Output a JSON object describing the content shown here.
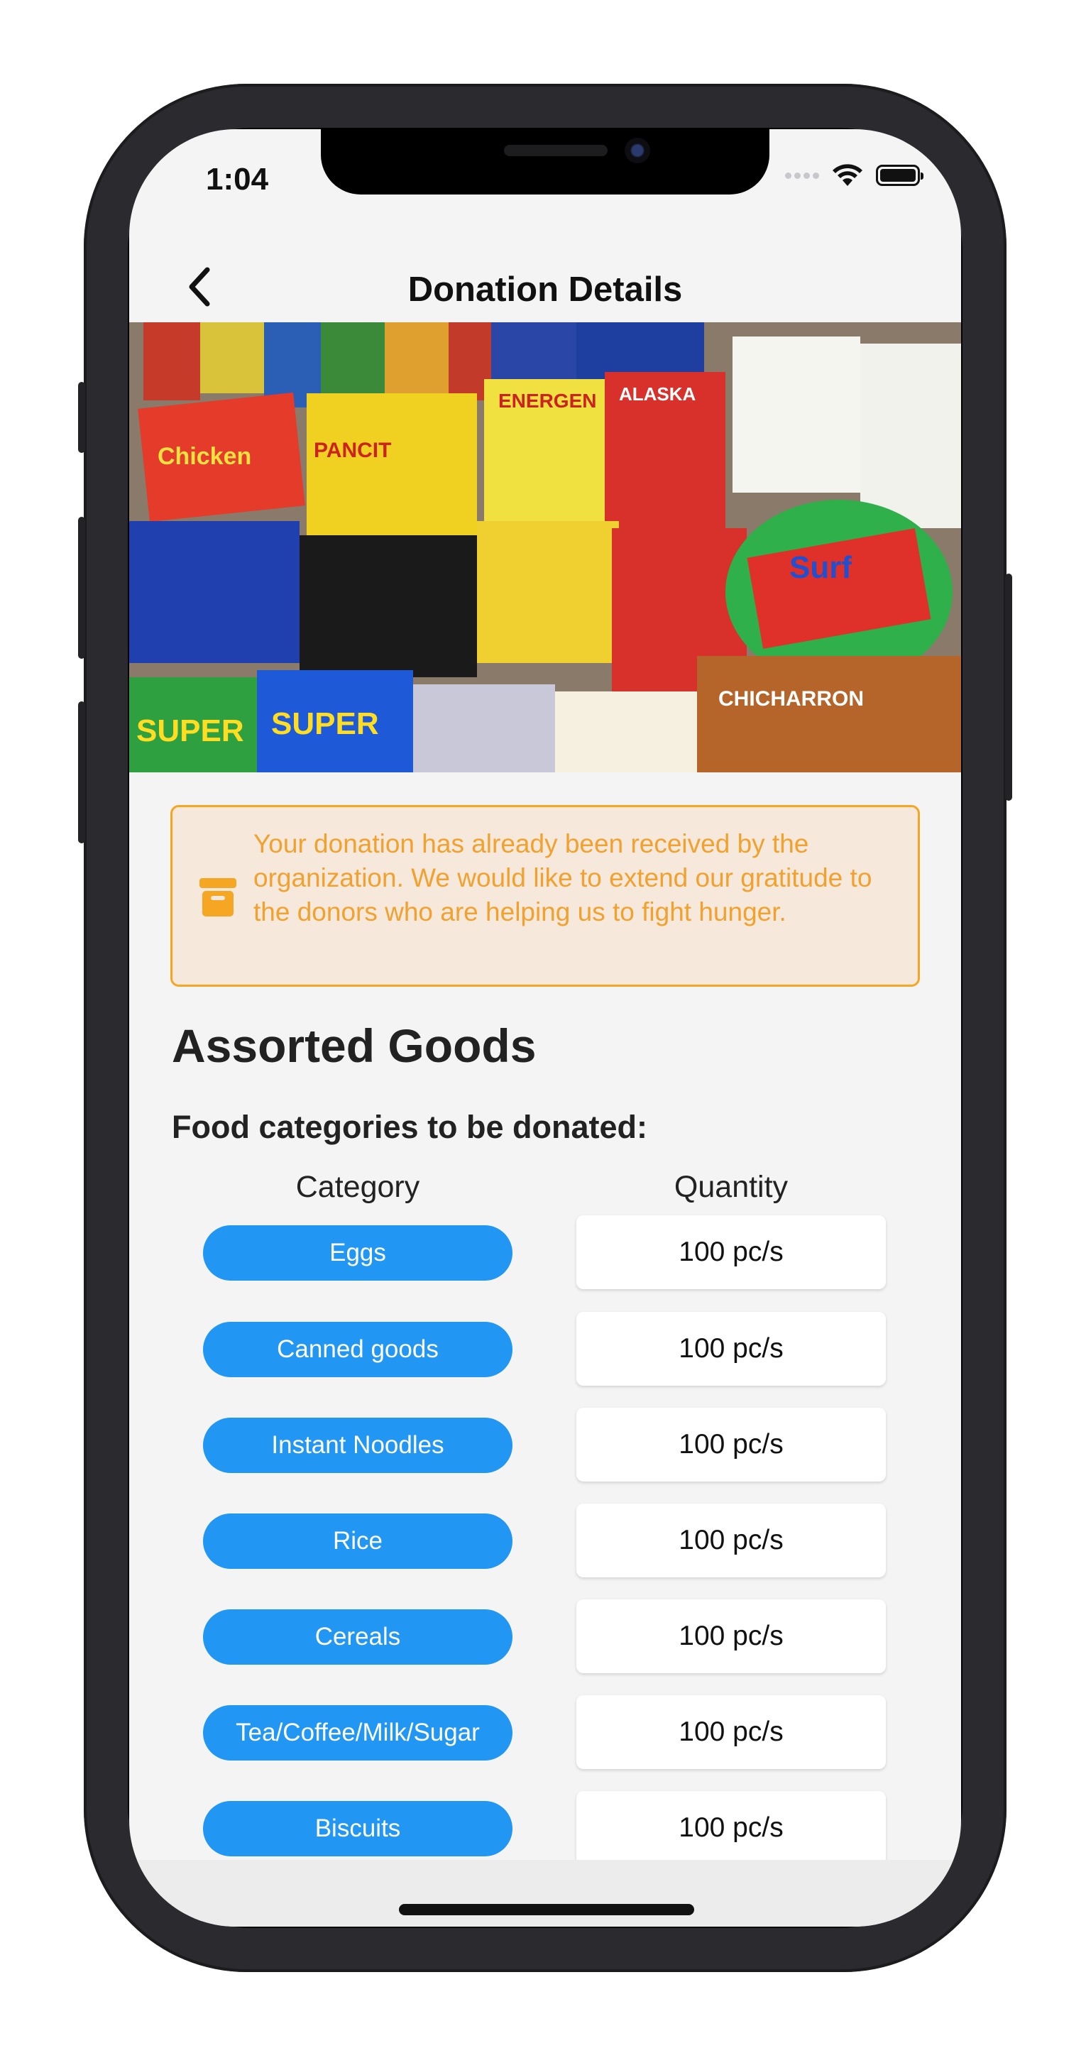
{
  "status_bar": {
    "time": "1:04"
  },
  "nav": {
    "title": "Donation Details",
    "back_icon": "chevron-left-icon"
  },
  "hero_image": {
    "description_icon": "donated-food-packages-photo"
  },
  "notice": {
    "icon": "archive-box-icon",
    "text": "Your donation has already been received by the organization. We would like to extend our gratitude to the donors who are helping us to fight hunger.",
    "border_color": "#f5a623",
    "background_color": "#f6e9dc",
    "text_color": "#f2a12f"
  },
  "donation": {
    "title": "Assorted Goods",
    "categories_heading": "Food categories to be donated:",
    "columns": {
      "category": "Category",
      "quantity": "Quantity"
    },
    "items": [
      {
        "category": "Eggs",
        "quantity": "100 pc/s"
      },
      {
        "category": "Canned goods",
        "quantity": "100 pc/s"
      },
      {
        "category": "Instant Noodles",
        "quantity": "100 pc/s"
      },
      {
        "category": "Rice",
        "quantity": "100 pc/s"
      },
      {
        "category": "Cereals",
        "quantity": "100 pc/s"
      },
      {
        "category": "Tea/Coffee/Milk/Sugar",
        "quantity": "100 pc/s"
      },
      {
        "category": "Biscuits",
        "quantity": "100 pc/s"
      }
    ]
  },
  "colors": {
    "accent": "#2196f3",
    "background": "#f4f4f4"
  }
}
